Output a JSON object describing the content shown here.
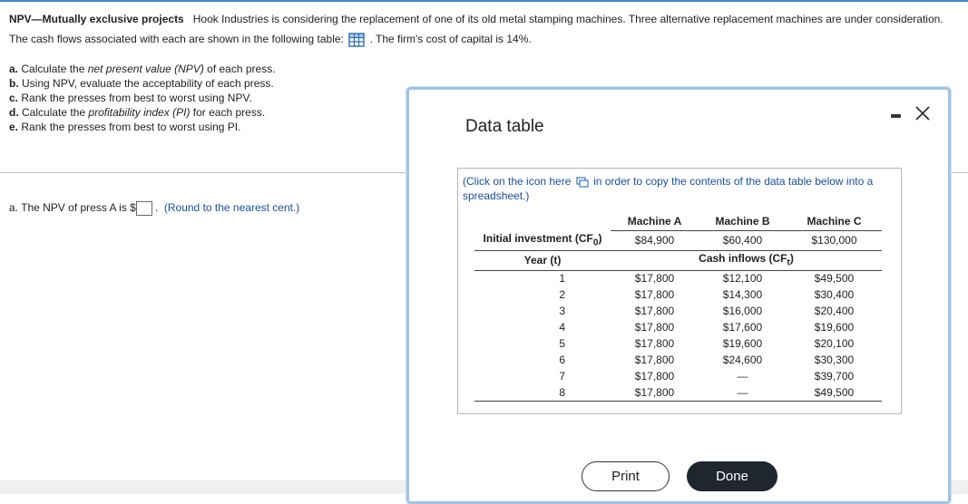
{
  "problem": {
    "title": "NPV—Mutually exclusive projects",
    "text_1": "Hook Industries is considering the replacement of one of its old metal stamping machines. Three alternative replacement machines are under consideration. The cash flows associated with each are shown in the following table:",
    "text_2": ". The firm's cost of capital is 14%."
  },
  "parts": [
    {
      "prefix": "a.",
      "pre": "Calculate the ",
      "em": "net present value (NPV)",
      "post": " of each press."
    },
    {
      "prefix": "b.",
      "pre": "Using NPV, evaluate the acceptability of each press.",
      "em": "",
      "post": ""
    },
    {
      "prefix": "c.",
      "pre": "Rank the presses from best to worst using NPV.",
      "em": "",
      "post": ""
    },
    {
      "prefix": "d.",
      "pre": "Calculate the ",
      "em": "profitability index (PI)",
      "post": " for each press."
    },
    {
      "prefix": "e.",
      "pre": "Rank the presses from best to worst using PI.",
      "em": "",
      "post": ""
    }
  ],
  "answer": {
    "label": "a. The NPV of press A is $",
    "value": "",
    "note": "(Round to the nearest cent.)"
  },
  "modal": {
    "title": "Data table",
    "copy_note_1": "(Click on the icon here",
    "copy_note_2": "in order to copy the contents of the data table below into a spreadsheet.)",
    "print_label": "Print",
    "done_label": "Done"
  },
  "table": {
    "headers": [
      "Machine A",
      "Machine B",
      "Machine C"
    ],
    "initial_label": "Initial investment (CF",
    "initial_sub": "0",
    "initial_values": [
      "$84,900",
      "$60,400",
      "$130,000"
    ],
    "year_label": "Year (t)",
    "cash_label": "Cash inflows (CF",
    "cash_sub": "t",
    "rows": [
      {
        "year": "1",
        "a": "$17,800",
        "b": "$12,100",
        "c": "$49,500"
      },
      {
        "year": "2",
        "a": "$17,800",
        "b": "$14,300",
        "c": "$30,400"
      },
      {
        "year": "3",
        "a": "$17,800",
        "b": "$16,000",
        "c": "$20,400"
      },
      {
        "year": "4",
        "a": "$17,800",
        "b": "$17,600",
        "c": "$19,600"
      },
      {
        "year": "5",
        "a": "$17,800",
        "b": "$19,600",
        "c": "$20,100"
      },
      {
        "year": "6",
        "a": "$17,800",
        "b": "$24,600",
        "c": "$30,300"
      },
      {
        "year": "7",
        "a": "$17,800",
        "b": "—",
        "c": "$39,700"
      },
      {
        "year": "8",
        "a": "$17,800",
        "b": "—",
        "c": "$49,500"
      }
    ]
  },
  "colors": {
    "link_blue": "#1a4fa0",
    "modal_border": "#9ec4e6",
    "done_button": "#1f2630"
  }
}
